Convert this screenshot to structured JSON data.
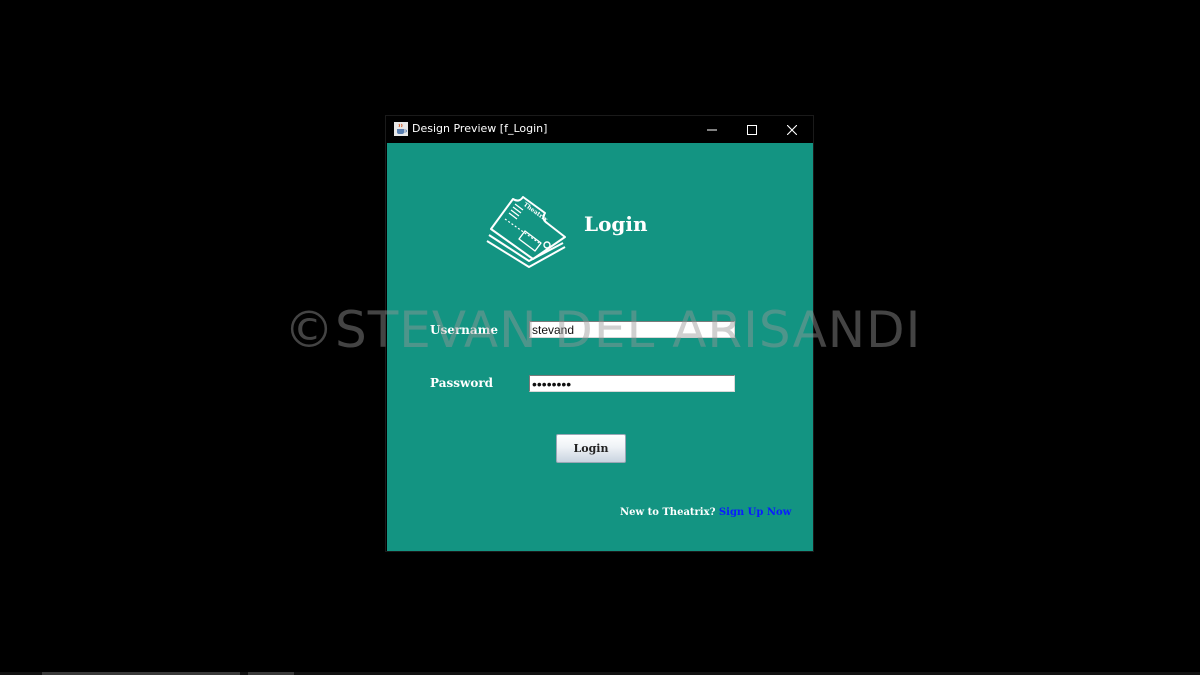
{
  "window": {
    "title": "Design Preview [f_Login]",
    "controls": {
      "minimize": "minimize",
      "maximize": "maximize",
      "close": "close"
    }
  },
  "login": {
    "heading": "Login",
    "username_label": "Username",
    "username_value": "stevand",
    "password_label": "Password",
    "password_value": "••••••••",
    "button_label": "Login"
  },
  "footer": {
    "prompt": "New to Theatrix?",
    "signup_link": "Sign Up Now"
  },
  "logo": {
    "brand_text": "Theatrix"
  },
  "watermark": "©STEVAN DEL ARISANDI",
  "colors": {
    "background": "#139482",
    "titlebar": "#000000",
    "link": "#0a1cff",
    "text": "#ffffff"
  },
  "icons": {
    "app": "java-coffee-icon",
    "logo": "ticket-icon"
  }
}
